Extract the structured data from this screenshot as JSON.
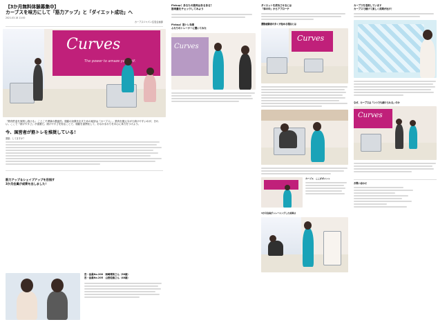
{
  "article": {
    "tag_line": "【3か月無料体験募集中】",
    "title_line": "カーブスを味方にして「筋力アップ」と「ダイエット成功」へ",
    "date": "2021.03.18 11:00",
    "credit": "カーブスジャパン広告企画部",
    "hero_banner": "Curves",
    "hero_tagline": "The power to amaze yourself.",
    "intro_caption": "「筋肉貯金を実践し続ける」 ことこそ健康の基盤的。運動の効果を出すための秘訣は「カーブス」。筋肉を鍛えながら続けやすいのが、きれい。ここで「続けやすさ」が重要だ。続けやすさを知ることで、運動を習慣化して、おなかまわりを中心に体力をつけよう。",
    "section_heading": "今、国営者が筋トレを推奨している！",
    "body_label": "運動、してますか？",
    "highlight_heading_1": "筋力アップ＆シェイプアップを目指す",
    "highlight_heading_2": "3か月会員が成果を出しました！",
    "member_1": "吉・会員No.200　岡崎博美さん（56歳）",
    "member_2": "吉・会員No.205　山田佐緒さん（48歳）"
  },
  "column2": {
    "title_1": "Pickup！あなたの筋肉はあるある？",
    "title_2": "筋肉量をチェックしてみよう",
    "subhead": "Pickup！筋トレ効果",
    "subhead_2": "ふたりのトレーナーに聞いてみた",
    "banner": "Curves"
  },
  "column3": {
    "title_1": "ダイエットを成功させるには",
    "title_2": "「体の中」からアプローチ",
    "subhead": "運動経験者の多くが始める理由とは",
    "subhead_2": "カーブス　ここがポイント",
    "banner": "Curves",
    "footer_label": "3か月会員がトレーニングした成果は"
  },
  "column4": {
    "title_1": "カーブスを活用しています",
    "title_2": "カーブスで続けて楽しく成果が出す！",
    "subhead": "なぜ、カーブスは「いつでも続けられる」のか",
    "banner": "Curves",
    "info_label": "お問い合わせ"
  },
  "colors": {
    "brand_magenta": "#c0207a",
    "trainer_teal": "#1aa3b8",
    "text_dark": "#111111"
  }
}
